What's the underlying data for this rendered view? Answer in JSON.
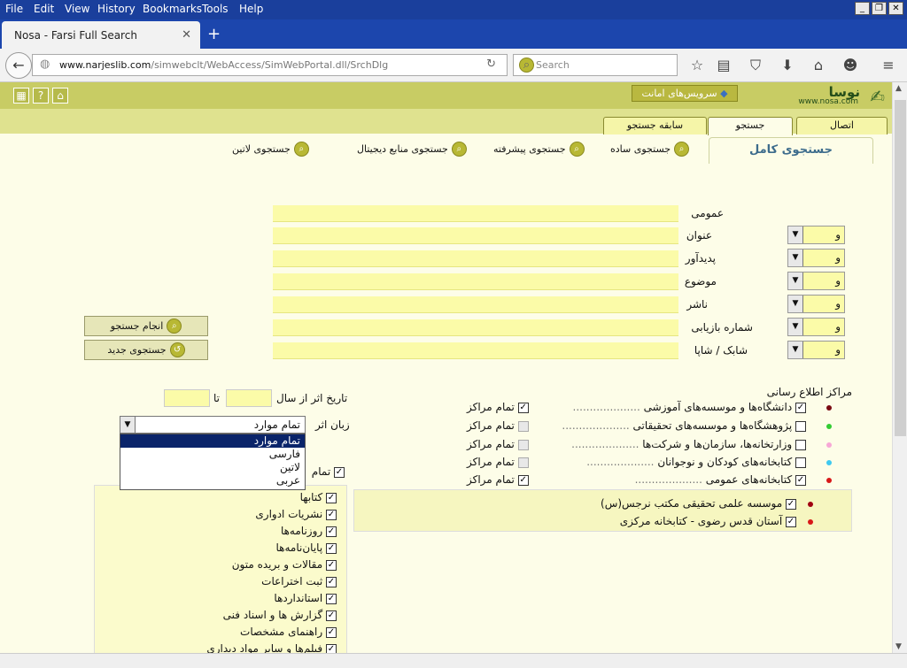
{
  "menubar": {
    "items": [
      "File",
      "Edit",
      "View",
      "History",
      "Bookmarks",
      "Tools",
      "Help"
    ]
  },
  "browser": {
    "tab_title": "Nosa - Farsi Full Search",
    "url_domain": "www.narjeslib.com",
    "url_path": "/simwebclt/WebAccess/SimWebPortal.dll/SrchDlg",
    "url_prefix": "",
    "search_placeholder": "Search"
  },
  "site": {
    "service_button": "سرویس‌های امانت",
    "logo_text": "نوسا",
    "logo_url": "www.nosa.com"
  },
  "tabs": {
    "history": "سابقه جستجو",
    "search": "جستجو",
    "connection": "اتصال"
  },
  "full_search": "جستجوی کامل",
  "subtabs": [
    "جستجوی ساده",
    "جستجوی پیشرفته",
    "جستجوی منابع دیجیتال",
    "جستجوی لاتین"
  ],
  "fields": [
    "عمومی",
    "عنوان",
    "پدیدآور",
    "موضوع",
    "ناشر",
    "شماره بازیابی",
    "شابک / شاپا"
  ],
  "and_value": "و",
  "buttons": {
    "do_search": "انجام جستجو",
    "new_search": "جستجوی جدید"
  },
  "year": {
    "label": "تاریخ اثر از سال",
    "to": "تا"
  },
  "language": {
    "label": "زبان اثر",
    "selected": "تمام موارد",
    "options": [
      "تمام موارد",
      "فارسی",
      "لاتین",
      "عربی"
    ]
  },
  "centers": {
    "title": "مراکز اطلاع رسانی",
    "all_label": "تمام مراکز",
    "rows": [
      {
        "label": "دانشگاه‌ها و موسسه‌های آموزشی",
        "checked": true,
        "color": "#7a0a12"
      },
      {
        "label": "پژوهشگاه‌ها و موسسه‌های تحقیقاتی",
        "checked": false,
        "color": "#33cc33"
      },
      {
        "label": "وزارتخانه‌ها، سازمان‌ها و شرکت‌ها",
        "checked": false,
        "color": "#f7a7d6"
      },
      {
        "label": "کتابخانه‌های کودکان و نوجوانان",
        "checked": false,
        "color": "#3fc9f0"
      },
      {
        "label": "کتابخانه‌های عمومی",
        "checked": true,
        "color": "#d81818"
      }
    ],
    "sub": [
      {
        "label": "موسسه علمی تحقیقی مکتب نرجس(س)",
        "color": "#a00010"
      },
      {
        "label": "آستان قدس رضوی - کتابخانه مرکزی",
        "color": "#d81818"
      }
    ]
  },
  "types": {
    "all_label": "تمام",
    "items": [
      "کتابها",
      "نشریات ادواری",
      "روزنامه‌ها",
      "پایان‌نامه‌ها",
      "مقالات و بریده متون",
      "ثبت اختراعات",
      "استانداردها",
      "گزارش ها و اسناد فنی",
      "راهنمای مشخصات",
      "فیلم‌ها و سایر مواد دیداری"
    ]
  }
}
